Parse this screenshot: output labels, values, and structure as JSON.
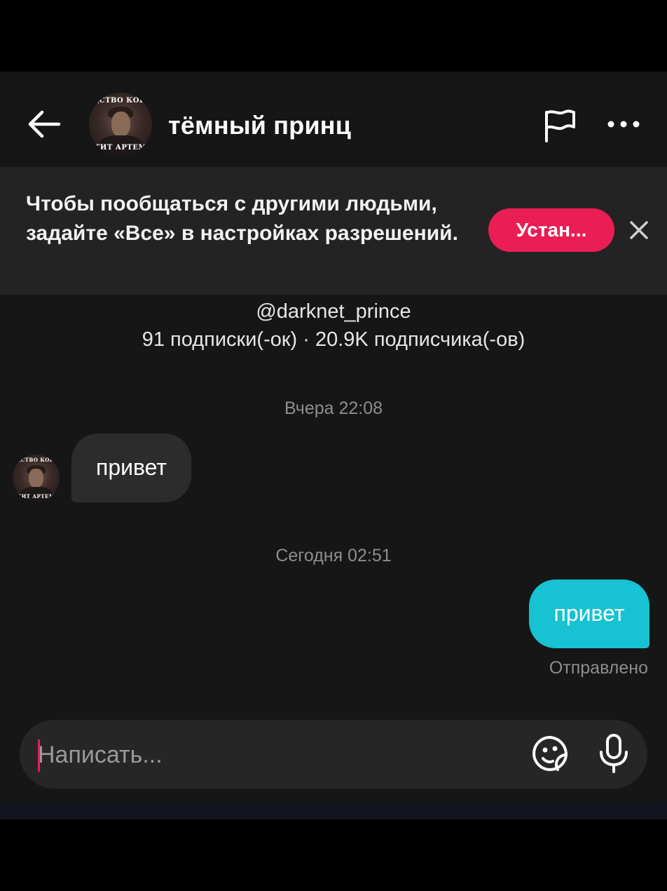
{
  "header": {
    "back_icon": "arrow-left-icon",
    "title": "тёмный принц",
    "avatar_caption_top": "ЩСТВО КОГД",
    "avatar_caption_bottom": "ТИТ АРТЕМ",
    "flag_icon": "flag-icon",
    "more_icon": "more-horizontal-icon"
  },
  "banner": {
    "text": "Чтобы пообщаться с другими людьми, задайте «Все» в настройках разрешений.",
    "button_label": "Устан...",
    "button_color": "#ea1d55",
    "close_icon": "close-icon"
  },
  "profile": {
    "handle": "@darknet_prince",
    "stats": "91 подписки(-ок) · 20.9K подписчика(-ов)"
  },
  "messages": [
    {
      "timestamp": "Вчера 22:08",
      "direction": "incoming",
      "text": "привет"
    },
    {
      "timestamp": "Сегодня 02:51",
      "direction": "outgoing",
      "text": "привет",
      "status": "Отправлено",
      "bubble_color": "#17c2d2"
    }
  ],
  "composer": {
    "placeholder": "Написать...",
    "emoji_icon": "sticker-emoji-icon",
    "mic_icon": "microphone-icon"
  }
}
